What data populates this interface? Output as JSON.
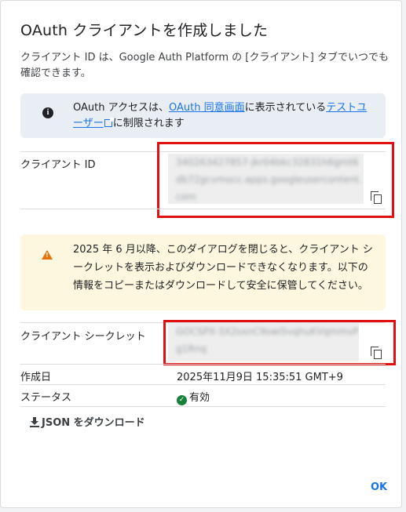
{
  "dialog": {
    "title": "OAuth クライアントを作成しました",
    "description": "クライアント ID は、Google Auth Platform の [クライアント] タブでいつでも確認できます。"
  },
  "info": {
    "icon": "info-icon",
    "text_before": "OAuth アクセスは、",
    "link1": "OAuth 同意画面",
    "text_middle": "に表示されている",
    "link2": "テストユーザー",
    "text_after": "に制限されます"
  },
  "client_id": {
    "label": "クライアント ID",
    "value": "340263427857-jkr04bkc32831h6gmt6db72gcvmocc.apps.googleusercontent.com",
    "copy_icon": "copy-icon"
  },
  "warning": {
    "icon": "warning-icon",
    "text": "2025 年 6 月以降、このダイアログを閉じると、クライアント シークレットを表示およびダウンロードできなくなります。以下の情報をコピーまたはダウンロードして安全に保管してください。"
  },
  "client_secret": {
    "label": "クライアント シークレット",
    "value": "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",
    "copy_icon": "copy-icon"
  },
  "created": {
    "label": "作成日",
    "value": "2025年11月9日 15:35:51 GMT+9"
  },
  "status": {
    "label": "ステータス",
    "value": "有効",
    "color": "#188038"
  },
  "actions": {
    "download_label": "JSON をダウンロード",
    "ok_label": "OK"
  },
  "colors": {
    "accent": "#1a73e8",
    "highlight": "#e01010",
    "warning": "#e8710a"
  }
}
